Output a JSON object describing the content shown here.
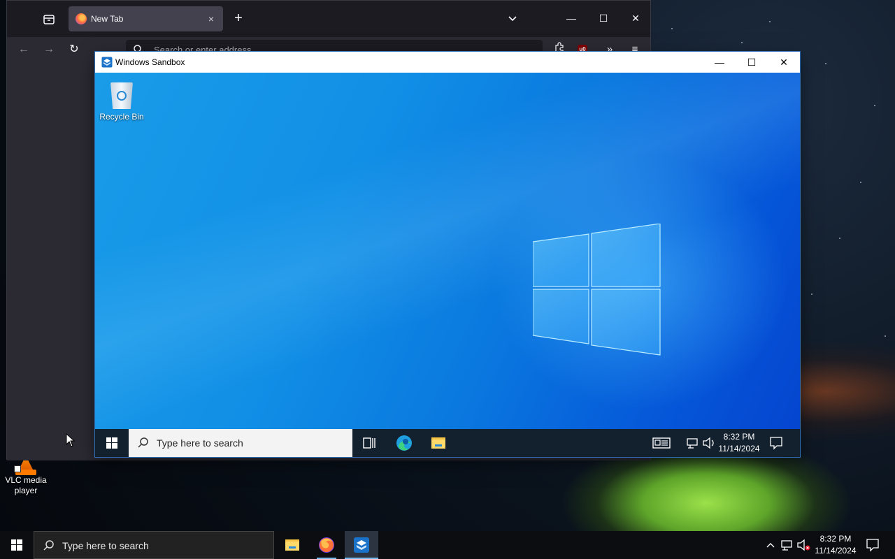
{
  "host": {
    "desktop_icons": [
      {
        "label": "VLC media player",
        "icon": "vlc-icon"
      }
    ],
    "taskbar": {
      "search_placeholder": "Type here to search",
      "pinned": [
        {
          "name": "file-explorer-icon"
        },
        {
          "name": "firefox-icon"
        },
        {
          "name": "windows-sandbox-icon",
          "active": true
        }
      ],
      "clock": {
        "time": "8:32 PM",
        "date": "11/14/2024"
      }
    }
  },
  "browser": {
    "tab": {
      "title": "New Tab",
      "close": "×"
    },
    "new_tab": "+",
    "window_controls": {
      "minimize": "—",
      "maximize": "☐",
      "close": "✕"
    },
    "nav": {
      "back": "←",
      "forward": "→",
      "reload": "↻"
    },
    "address_placeholder": "Search or enter address",
    "ublock_badge": "u0",
    "overflow": "»",
    "menu": "≡"
  },
  "sandbox": {
    "title": "Windows Sandbox",
    "window_controls": {
      "minimize": "—",
      "maximize": "☐",
      "close": "✕"
    },
    "desktop_icons": [
      {
        "label": "Recycle Bin",
        "icon": "recycle-bin-icon"
      }
    ],
    "taskbar": {
      "search_placeholder": "Type here to search",
      "clock": {
        "time": "8:32 PM",
        "date": "11/14/2024"
      }
    },
    "colors": {
      "wallpaper_blue": "#0a78df",
      "taskbar": "#13202e"
    }
  }
}
